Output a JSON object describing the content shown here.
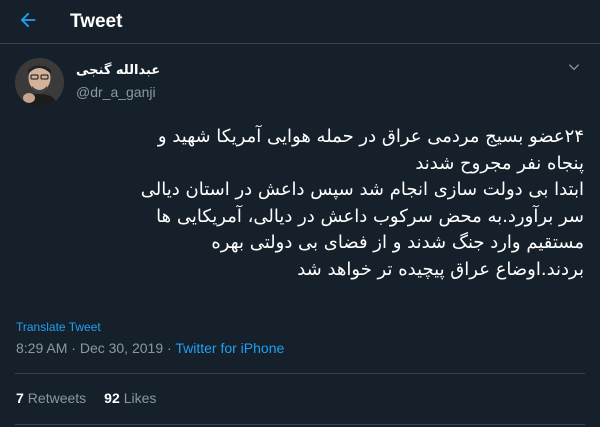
{
  "header": {
    "title": "Tweet",
    "back_icon": "arrow-left-icon"
  },
  "author": {
    "name": "عبدالله گنجی",
    "handle": "@dr_a_ganji"
  },
  "tweet": {
    "lines": [
      "۲۴عضو بسیج مردمی عراق در حمله هوایی آمریکا شهید و",
      "پنجاه نفر مجروح شدند",
      "ابتدا بی دولت سازی انجام شد سپس داعش در استان دیالی",
      "سر برآورد.به محض سرکوب داعش در دیالی، آمریکایی ها",
      "مستقیم وارد جنگ شدند و از فضای بی دولتی بهره",
      "بردند.اوضاع عراق پیچیده تر خواهد شد"
    ],
    "translate_label": "Translate Tweet",
    "time": "8:29 AM",
    "date": "Dec 30, 2019",
    "separator": "·",
    "source": "Twitter for iPhone"
  },
  "stats": {
    "retweets_count": "7",
    "retweets_label": "Retweets",
    "likes_count": "92",
    "likes_label": "Likes"
  },
  "colors": {
    "background": "#15202b",
    "accent": "#1da1f2",
    "secondary_text": "#8899a6",
    "divider": "#38444d"
  }
}
